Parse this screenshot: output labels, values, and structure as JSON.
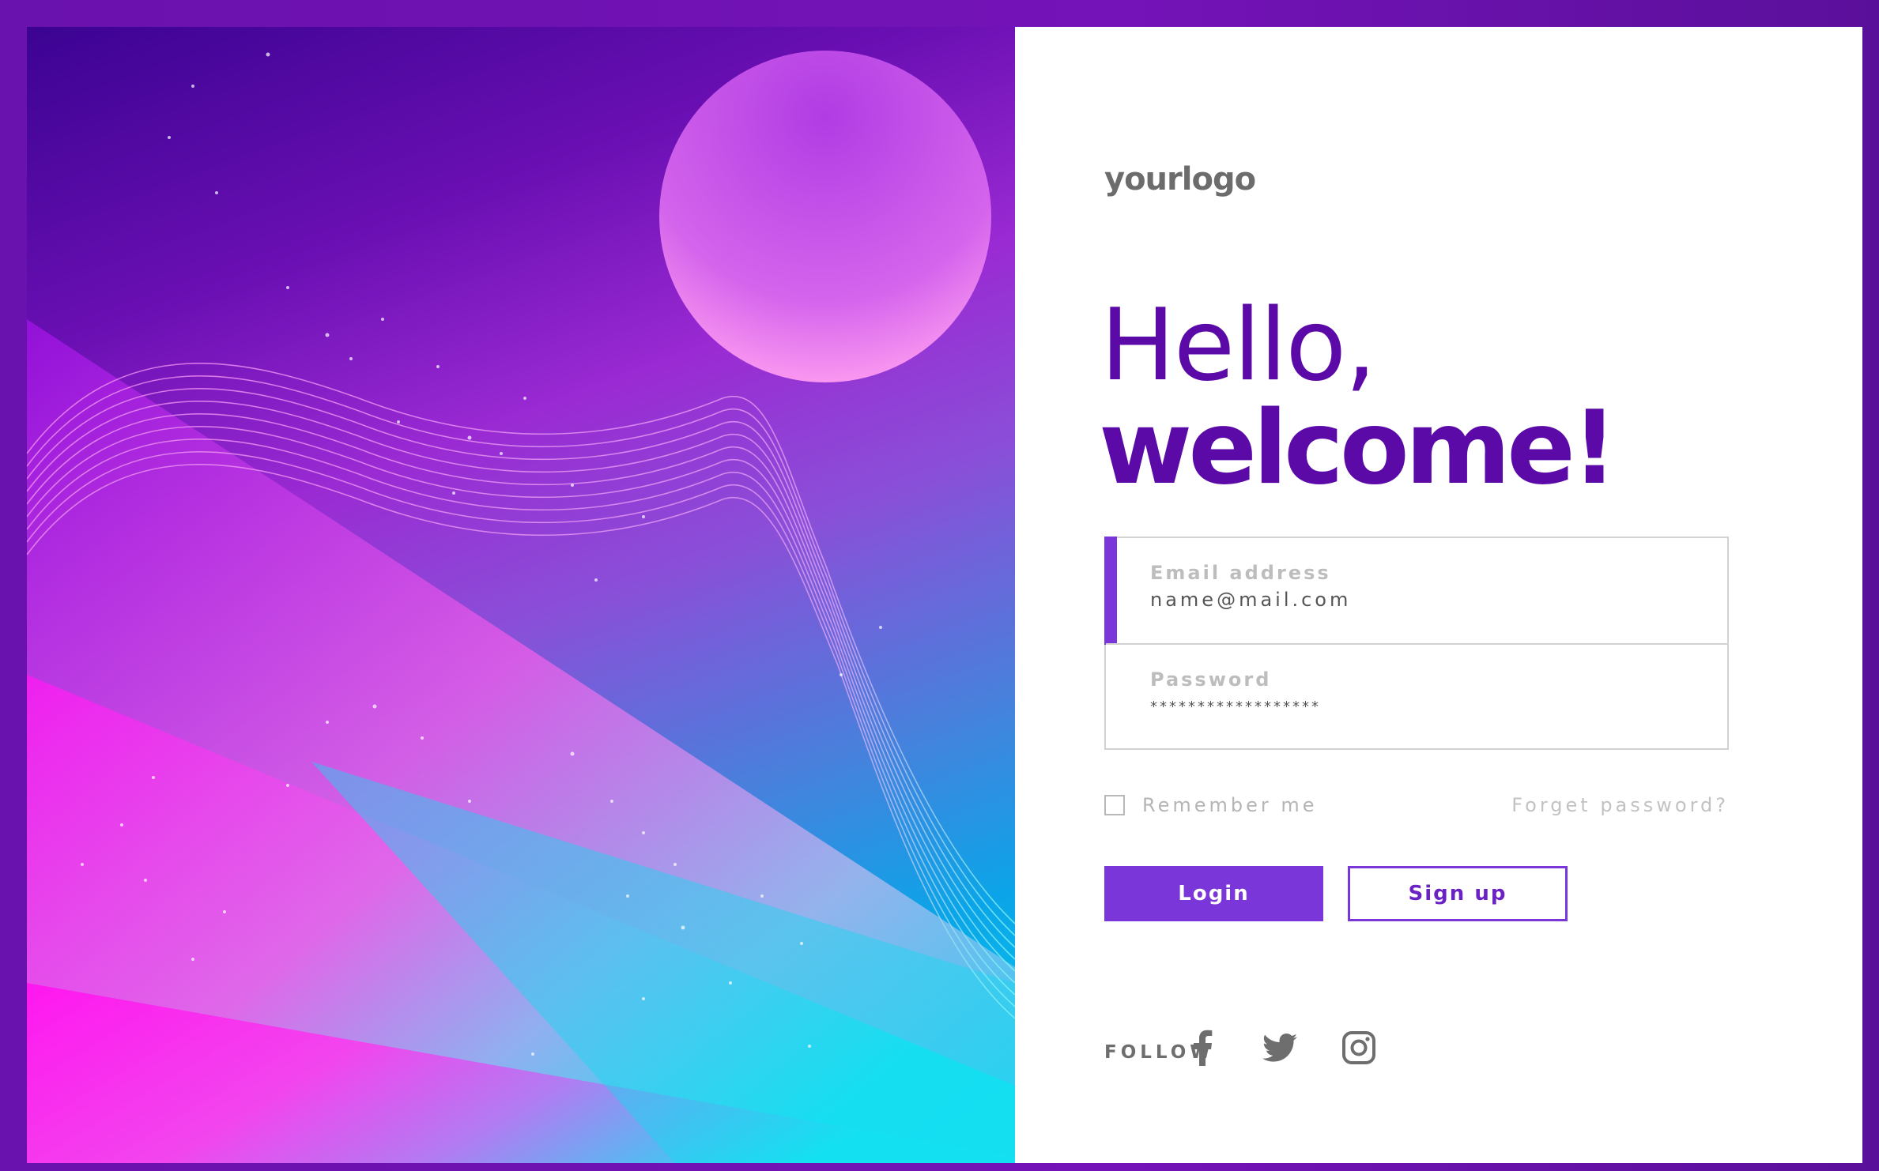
{
  "brand": {
    "logo_text": "yourlogo",
    "accent_color": "#7a36d8",
    "heading_color": "#5b0aa8"
  },
  "heading": {
    "line1": "Hello,",
    "line2": "welcome!"
  },
  "form": {
    "email": {
      "label": "Email address",
      "value": "name@mail.com"
    },
    "password": {
      "label": "Password",
      "value": "******************"
    },
    "remember_label": "Remember me",
    "remember_checked": false,
    "forgot_label": "Forget password?"
  },
  "buttons": {
    "login_label": "Login",
    "signup_label": "Sign up"
  },
  "social": {
    "follow_label": "FOLLOW",
    "icons": [
      "facebook-icon",
      "twitter-icon",
      "instagram-icon"
    ]
  }
}
